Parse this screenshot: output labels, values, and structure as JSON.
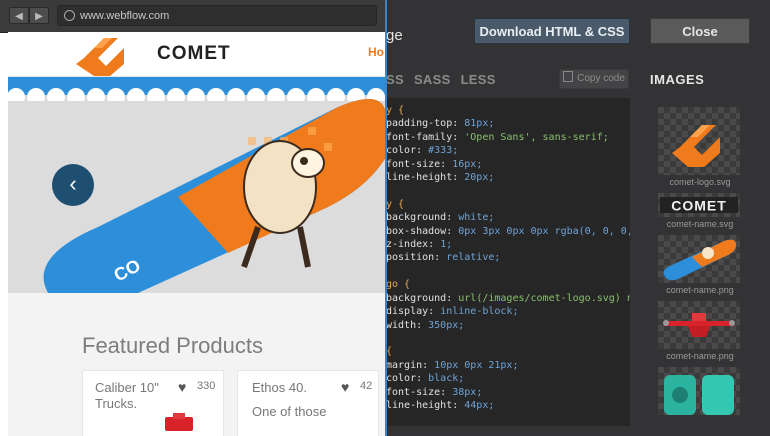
{
  "browser": {
    "back_glyph": "◀",
    "forward_glyph": "▶",
    "url": "www.webflow.com"
  },
  "site": {
    "brand": "COMET",
    "nav_home": "Ho",
    "featured_title": "Featured Products",
    "products": [
      {
        "name_line1": "Caliber 10\"",
        "name_line2": "Trucks.",
        "likes": "330"
      },
      {
        "name_line1": "Ethos 40.",
        "name_line2": "One of those",
        "likes": "42"
      }
    ],
    "hero_arrow": "‹"
  },
  "panel": {
    "title": "ge",
    "download_label": "Download HTML & CSS",
    "close_label": "Close",
    "lang_tabs": [
      "SS",
      "SASS",
      "LESS"
    ],
    "copy_label": "Copy code",
    "images_heading": "IMAGES",
    "images": [
      {
        "caption": "comet-logo.svg"
      },
      {
        "caption": "comet-name.svg"
      },
      {
        "caption": "comet-name.png"
      },
      {
        "caption": "comet-name.png"
      },
      {
        "caption": ""
      }
    ]
  },
  "code_lines": [
    "y {",
    "padding-top: 81px;",
    "font-family: 'Open Sans', sans-serif;",
    "color: #333;",
    "font-size: 16px;",
    "line-height: 20px;",
    "",
    "y {",
    "background: white;",
    "box-shadow: 0px 3px 0px 0px rgba(0, 0, 0,",
    "z-index: 1;",
    "position: relative;",
    "",
    "go {",
    "background: url(/images/comet-logo.svg) no",
    "display: inline-block;",
    "width: 350px;",
    "",
    "{",
    "margin: 10px 0px 21px;",
    "color: black;",
    "font-size: 38px;",
    "line-height: 44px;"
  ],
  "colors": {
    "accent_orange": "#f07b1d",
    "nav_arrow_blue": "#1f4f70",
    "divider_blue": "#2f86d4",
    "board_blue": "#2d8fd9"
  }
}
